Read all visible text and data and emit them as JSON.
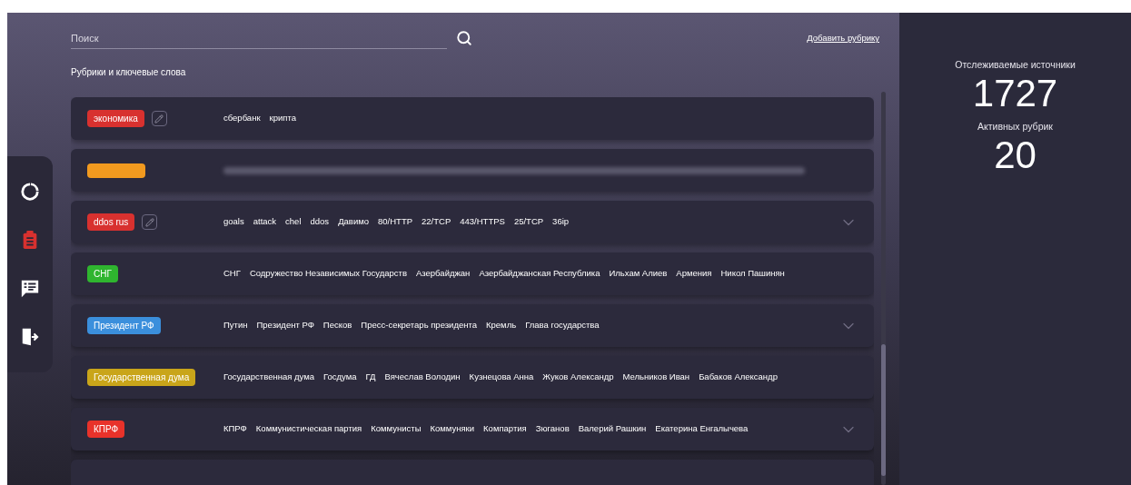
{
  "sidebar": {
    "items": [
      {
        "selected": false
      },
      {
        "selected": true
      },
      {
        "selected": false
      },
      {
        "selected": false
      }
    ]
  },
  "search": {
    "placeholder": "Поиск"
  },
  "add_link": "Добавить рубрику",
  "section_title": "Рубрики и ключевые слова",
  "rubrics": [
    {
      "kind": "tag",
      "name": "экономика",
      "color": "#d8312f",
      "editable": true,
      "expandable": false,
      "keywords": [
        "сбербанк",
        "крипта"
      ]
    },
    {
      "kind": "redacted",
      "color": "#f29a1f",
      "editable": false,
      "expandable": false
    },
    {
      "kind": "tag",
      "name": "ddos rus",
      "color": "#d8312f",
      "editable": true,
      "expandable": true,
      "keywords": [
        "goals",
        "attack",
        "chel",
        "ddos",
        "Давимо",
        "80/HTTP",
        "22/TCP",
        "443/HTTPS",
        "25/TCP",
        "36ip"
      ]
    },
    {
      "kind": "tag",
      "name": "СНГ",
      "color": "#2fb52f",
      "editable": false,
      "expandable": false,
      "keywords": [
        "СНГ",
        "Содружество Независимых Государств",
        "Азербайджан",
        "Азербайджанская Республика",
        "Ильхам Алиев",
        "Армения",
        "Никол Пашинян"
      ]
    },
    {
      "kind": "tag",
      "name": "Президент РФ",
      "color": "#3b8fdc",
      "editable": false,
      "expandable": true,
      "keywords": [
        "Путин",
        "Президент РФ",
        "Песков",
        "Пресс-секретарь президента",
        "Кремль",
        "Глава государства"
      ]
    },
    {
      "kind": "tag",
      "name": "Государственная дума",
      "color": "#c9a51a",
      "editable": false,
      "expandable": false,
      "keywords": [
        "Государственная дума",
        "Госдума",
        "ГД",
        "Вячеслав Володин",
        "Кузнецова Анна",
        "Жуков Александр",
        "Мельников Иван",
        "Бабаков Александр"
      ]
    },
    {
      "kind": "tag",
      "name": "КПРФ",
      "color": "#e8322a",
      "editable": false,
      "expandable": true,
      "keywords": [
        "КПРФ",
        "Коммунистическая партия",
        "Коммунисты",
        "Коммуняки",
        "Компартия",
        "Зюганов",
        "Валерий Рашкин",
        "Екатерина Енгалычева"
      ]
    },
    {
      "kind": "empty"
    }
  ],
  "stats": [
    {
      "label": "Отслеживаемые источники",
      "value": "1727"
    },
    {
      "label": "Активных рубрик",
      "value": "20"
    }
  ]
}
